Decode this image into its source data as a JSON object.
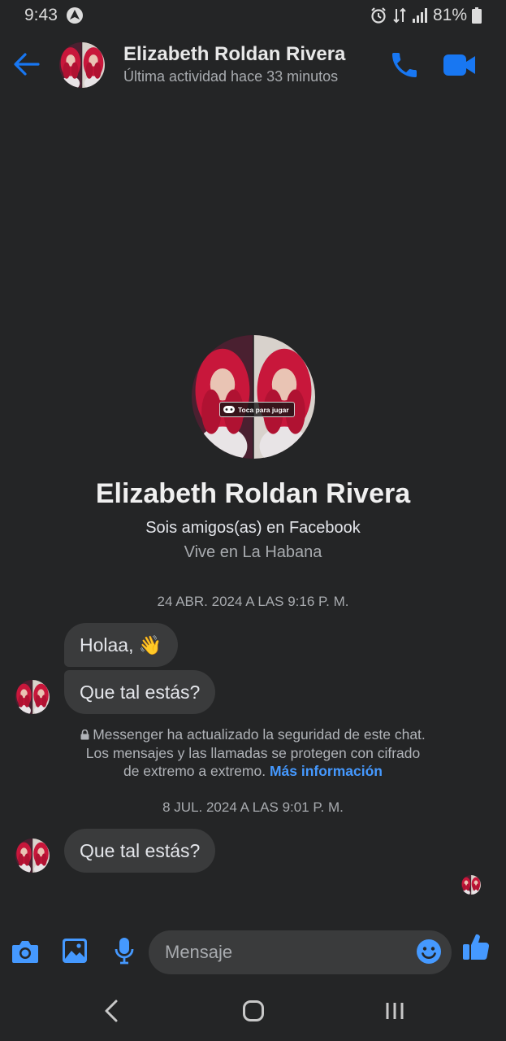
{
  "status_bar": {
    "time": "9:43",
    "battery": "81%",
    "icons": [
      "android-auto-icon",
      "alarm-icon",
      "data-arrows-icon",
      "signal-icon",
      "battery-icon"
    ]
  },
  "header": {
    "name": "Elizabeth Roldan Rivera",
    "status": "Última actividad hace 33 minutos",
    "icons": [
      "back-arrow-icon",
      "phone-icon",
      "video-camera-icon"
    ],
    "accent": "#1877f2"
  },
  "profile": {
    "name": "Elizabeth Roldan Rivera",
    "friends": "Sois amigos(as) en Facebook",
    "location": "Vive en La Habana",
    "avatar_badge": "Toca para jugar"
  },
  "conversation": {
    "timestamp_1": "24 ABR. 2024 A LAS 9:16 P. M.",
    "message_1": "Holaa, 👋",
    "message_2": "Que tal estás?",
    "security_line_1": "Messenger ha actualizado la seguridad de este chat.",
    "security_line_2": "Los mensajes y las llamadas se protegen con cifrado",
    "security_line_3": "de extremo a extremo.",
    "security_link": "Más información",
    "timestamp_2": "8 JUL. 2024 A LAS 9:01 P. M.",
    "message_3": "Que tal estás?"
  },
  "composer": {
    "placeholder": "Mensaje",
    "icons": [
      "camera-icon",
      "gallery-icon",
      "microphone-icon",
      "emoji-icon",
      "thumbs-up-icon"
    ]
  },
  "nav_bar": {
    "icons": [
      "nav-back-icon",
      "nav-home-icon",
      "nav-recents-icon"
    ]
  },
  "colors": {
    "background": "#242526",
    "bubble": "#3a3b3c",
    "accent": "#1877f2",
    "link": "#4599ff",
    "secondary_text": "#a8abaf"
  }
}
